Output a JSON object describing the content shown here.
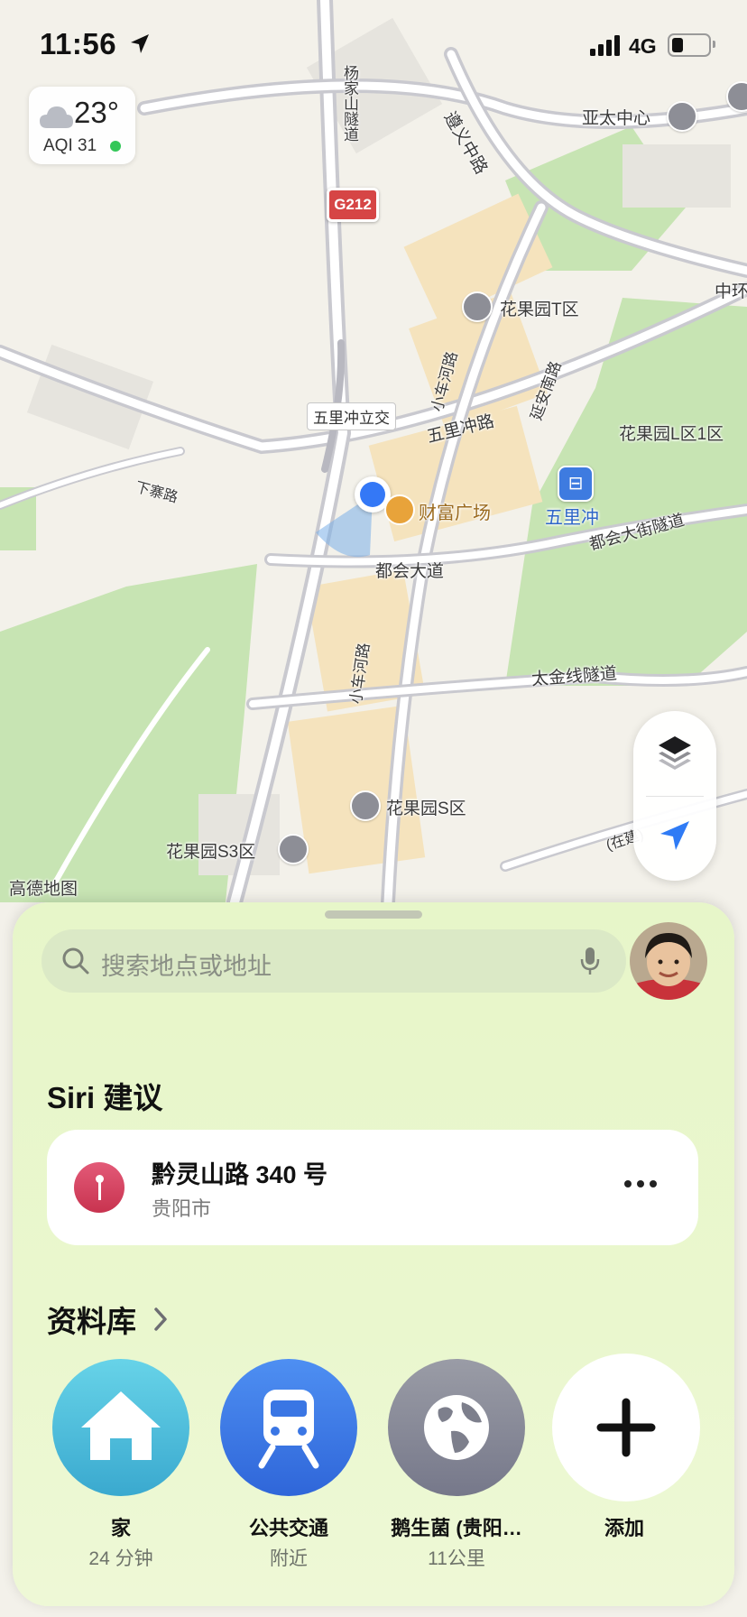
{
  "status": {
    "time": "11:56",
    "network": "4G"
  },
  "weather": {
    "temp": "23°",
    "aqi": "AQI 31",
    "icon": "cloud-icon"
  },
  "map": {
    "attribution": "高德地图",
    "labels": {
      "yangjiashan_tunnel": "杨家山隧道",
      "zunyi_middle_road": "遵义中路",
      "yatai_center": "亚太中心",
      "g212": "G212",
      "huaguoyuan_t": "花果园T区",
      "zhonghuan": "中环",
      "xiaochehe_road_north": "小车河路",
      "yanan_south_road": "延安南路",
      "wulichong_interchange": "五里冲立交",
      "wulichong_road": "五里冲路",
      "huaguoyuan_l1": "花果园L区1区",
      "xiazhai_road": "下寨路",
      "caifu_plaza": "财富广场",
      "wulichong_station": "五里冲",
      "duhui_tunnel": "都会大街隧道",
      "duhui_avenue": "都会大道",
      "xiaochehe_road_south": "小车河路",
      "taijinxian_tunnel": "太金线隧道",
      "huaguoyuan_s": "花果园S区",
      "huaguoyuan_s3": "花果园S3区",
      "under_construction": "(在建)"
    }
  },
  "search": {
    "placeholder": "搜索地点或地址"
  },
  "siri": {
    "heading": "Siri 建议",
    "suggestion": {
      "title": "黔灵山路 340 号",
      "subtitle": "贵阳市"
    }
  },
  "library": {
    "heading": "资料库",
    "items": [
      {
        "name": "家",
        "sub": "24 分钟",
        "icon": "home-icon",
        "color": "#4fbfd9"
      },
      {
        "name": "公共交通",
        "sub": "附近",
        "icon": "train-icon",
        "color": "#3f7de6"
      },
      {
        "name": "鹅生菌 (贵阳…",
        "sub": "11公里",
        "icon": "globe-icon",
        "color": "#8a8c96"
      },
      {
        "name": "添加",
        "sub": "",
        "icon": "plus-icon",
        "color": "#ffffff"
      }
    ]
  }
}
